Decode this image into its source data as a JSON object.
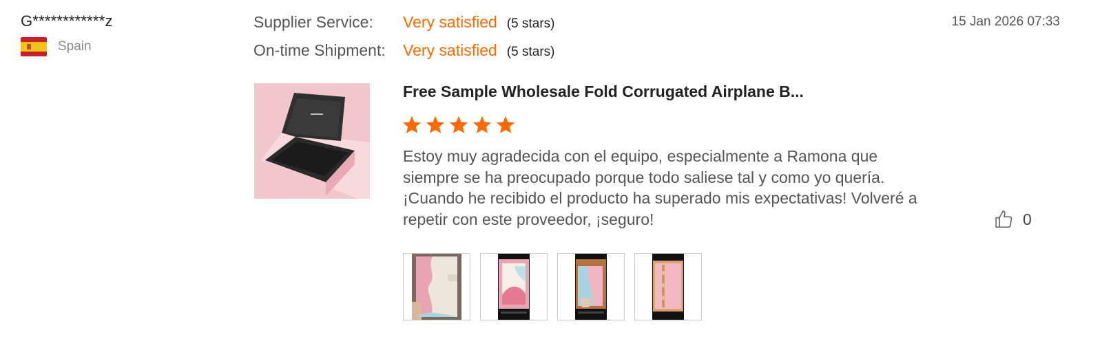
{
  "reviewer": {
    "name": "G************z",
    "country": "Spain",
    "flag_icon": "spain-flag-icon"
  },
  "ratings": [
    {
      "label": "Supplier Service:",
      "value": "Very satisfied",
      "stars_text": "(5 stars)"
    },
    {
      "label": "On-time Shipment:",
      "value": "Very satisfied",
      "stars_text": "(5 stars)"
    }
  ],
  "date": "15 Jan 2026 07:33",
  "product": {
    "title": "Free Sample Wholesale Fold Corrugated Airplane B...",
    "rating": 5,
    "max_rating": 5
  },
  "comment": "Estoy muy agradecida con el equipo, especialmente a Ramona que siempre se ha preocupado porque todo saliese tal y como yo quería. ¡Cuando he recibido el producto ha superado mis expectativas! Volveré a repetir con este proveedor, ¡seguro!",
  "like": {
    "icon": "thumbs-up-icon",
    "count": "0"
  },
  "photos": [
    {
      "icon": "photo-thumbnail-1"
    },
    {
      "icon": "photo-thumbnail-2"
    },
    {
      "icon": "photo-thumbnail-3"
    },
    {
      "icon": "photo-thumbnail-4"
    }
  ],
  "colors": {
    "accent": "#ff6a00",
    "text_muted": "#555555",
    "product_bg": "#f2c6cd"
  }
}
